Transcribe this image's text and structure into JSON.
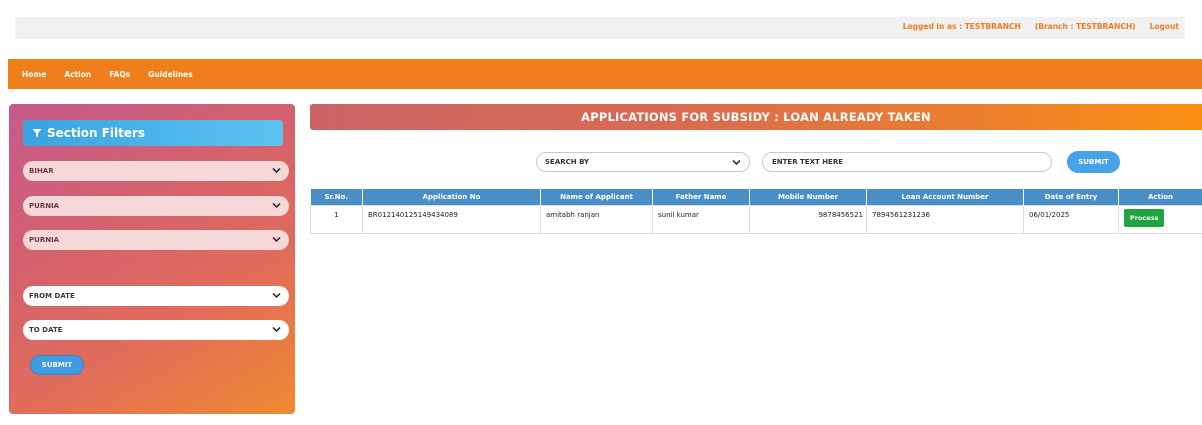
{
  "topbar": {
    "logged_in": "Logged in as : TESTBRANCH",
    "branch": "(Branch : TESTBRANCH)",
    "logout": "Logout"
  },
  "nav": {
    "items": [
      {
        "label": "Home"
      },
      {
        "label": "Action"
      },
      {
        "label": "FAQs"
      },
      {
        "label": "Guidelines"
      }
    ]
  },
  "sidebar": {
    "title": "Section Filters",
    "selects": [
      {
        "value": "BIHAR"
      },
      {
        "value": "PURNIA"
      },
      {
        "value": "PURNIA"
      },
      {
        "value": "FROM DATE"
      },
      {
        "value": "TO DATE"
      }
    ],
    "submit_label": "SUBMIT"
  },
  "main": {
    "banner": "APPLICATIONS FOR SUBSIDY : LOAN ALREADY TAKEN",
    "search_by": "SEARCH BY",
    "search_placeholder": "ENTER TEXT HERE",
    "submit_label": "SUBMIT"
  },
  "table": {
    "headers": [
      "Sr.No.",
      "Application No",
      "Name of Applicant",
      "Father Name",
      "Mobile Number",
      "Loan Account Number",
      "Date of Entry",
      "Action"
    ],
    "rows": [
      {
        "sr_no": "1",
        "application_no": "BR012140125149434089",
        "applicant": "amitabh ranjan",
        "father": "sunil kumar",
        "mobile": "9878456521",
        "loan_account": "7894561231236",
        "date": "06/01/2025",
        "action": "Process"
      }
    ]
  },
  "colors": {
    "accent_orange": "#ee7f1c",
    "header_blue": "#4a8ec8",
    "process_green": "#1ea53f",
    "submit_blue": "#3f9be3"
  },
  "icons": [
    "filter-icon",
    "chevron-down-icon"
  ]
}
